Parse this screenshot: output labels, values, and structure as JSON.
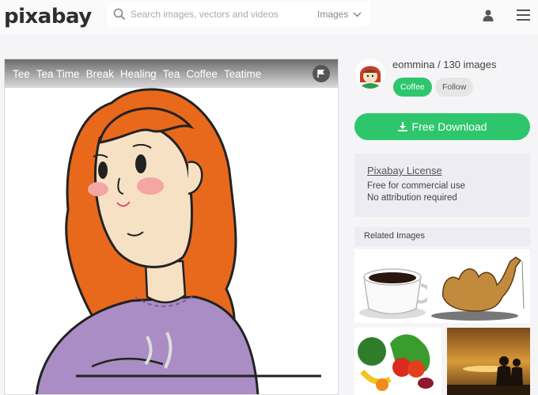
{
  "header": {
    "logo": "pixabay",
    "search_placeholder": "Search images, vectors and videos",
    "type_select": "Images"
  },
  "tags": [
    "Tee",
    "Tea Time",
    "Break",
    "Healing",
    "Tea",
    "Coffee",
    "Teatime"
  ],
  "author": {
    "line": "eommina / 130 images",
    "coffee_label": "Coffee",
    "follow_label": "Follow"
  },
  "download_label": "Free Download",
  "license": {
    "title": "Pixabay License",
    "line1": "Free for commercial use",
    "line2": "No attribution required"
  },
  "related_title": "Related Images",
  "colors": {
    "accent": "#2ec66d",
    "hair": "#e8691c",
    "sweater": "#a98dc4"
  },
  "icons": [
    "search-icon",
    "chevron-down-icon",
    "user-icon",
    "menu-icon",
    "flag-icon",
    "download-icon"
  ]
}
